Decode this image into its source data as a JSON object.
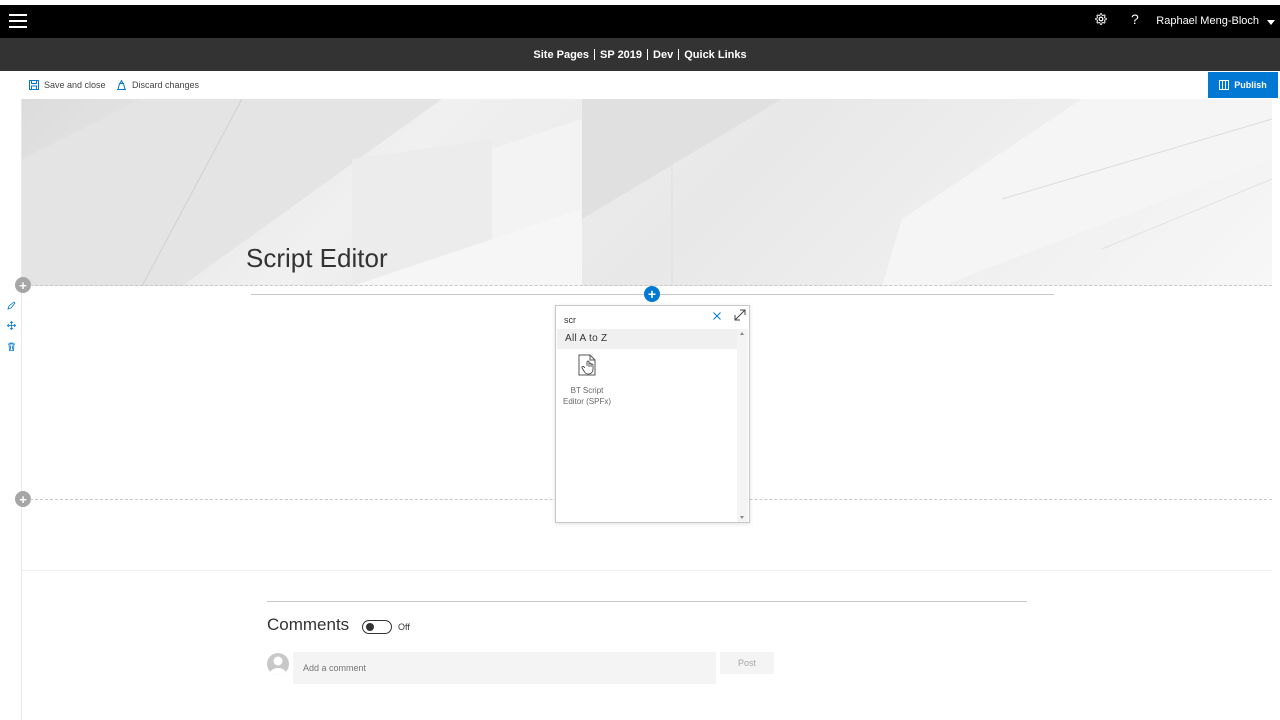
{
  "suite_bar": {
    "settings_icon": "gear-icon",
    "help_label": "?",
    "user_name": "Raphael Meng-Bloch"
  },
  "nav": {
    "items": [
      "Site Pages",
      "SP 2019",
      "Dev",
      "Quick Links"
    ]
  },
  "command_bar": {
    "save_label": "Save and close",
    "discard_label": "Discard changes",
    "publish_label": "Publish"
  },
  "page": {
    "title": "Script Editor"
  },
  "toolbox": {
    "search_value": "scr",
    "section_header": "All A to Z",
    "items": [
      {
        "label_line1": "BT Script",
        "label_line2": "Editor (SPFx)"
      }
    ]
  },
  "comments": {
    "title": "Comments",
    "toggle_state": "Off",
    "input_placeholder": "Add a comment",
    "post_label": "Post"
  },
  "colors": {
    "accent": "#0078d4",
    "suite_bar": "#000000",
    "nav_bar": "#333333"
  }
}
